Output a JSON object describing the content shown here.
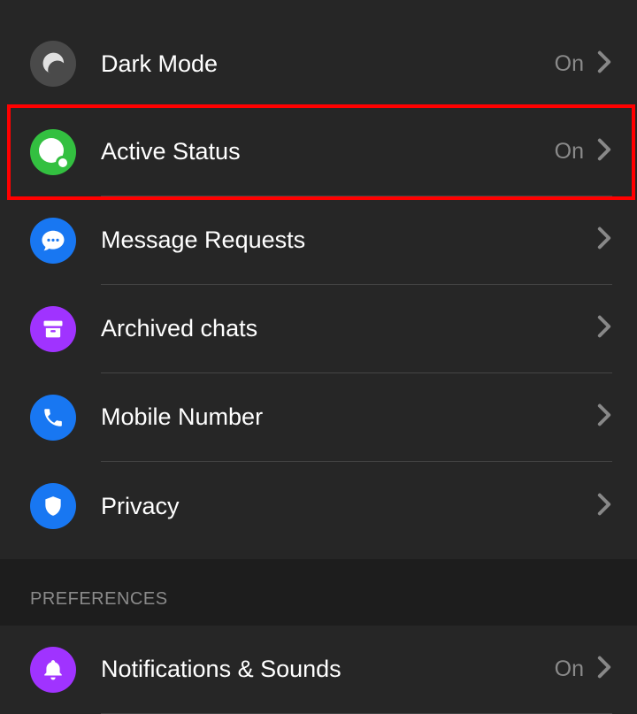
{
  "rows": {
    "dark_mode": {
      "label": "Dark Mode",
      "value": "On"
    },
    "active_status": {
      "label": "Active Status",
      "value": "On"
    },
    "message_requests": {
      "label": "Message Requests"
    },
    "archived_chats": {
      "label": "Archived chats"
    },
    "mobile_number": {
      "label": "Mobile Number"
    },
    "privacy": {
      "label": "Privacy"
    },
    "notifications_sounds": {
      "label": "Notifications & Sounds",
      "value": "On"
    }
  },
  "section": {
    "preferences": "PREFERENCES"
  },
  "colors": {
    "dark_mode_bg": "#4a4a4a",
    "active_status_bg": "#33c040",
    "message_requests_bg": "#1877f2",
    "archived_chats_bg": "#a033ff",
    "mobile_number_bg": "#1877f2",
    "privacy_bg": "#1877f2",
    "notifications_bg": "#a033ff"
  }
}
